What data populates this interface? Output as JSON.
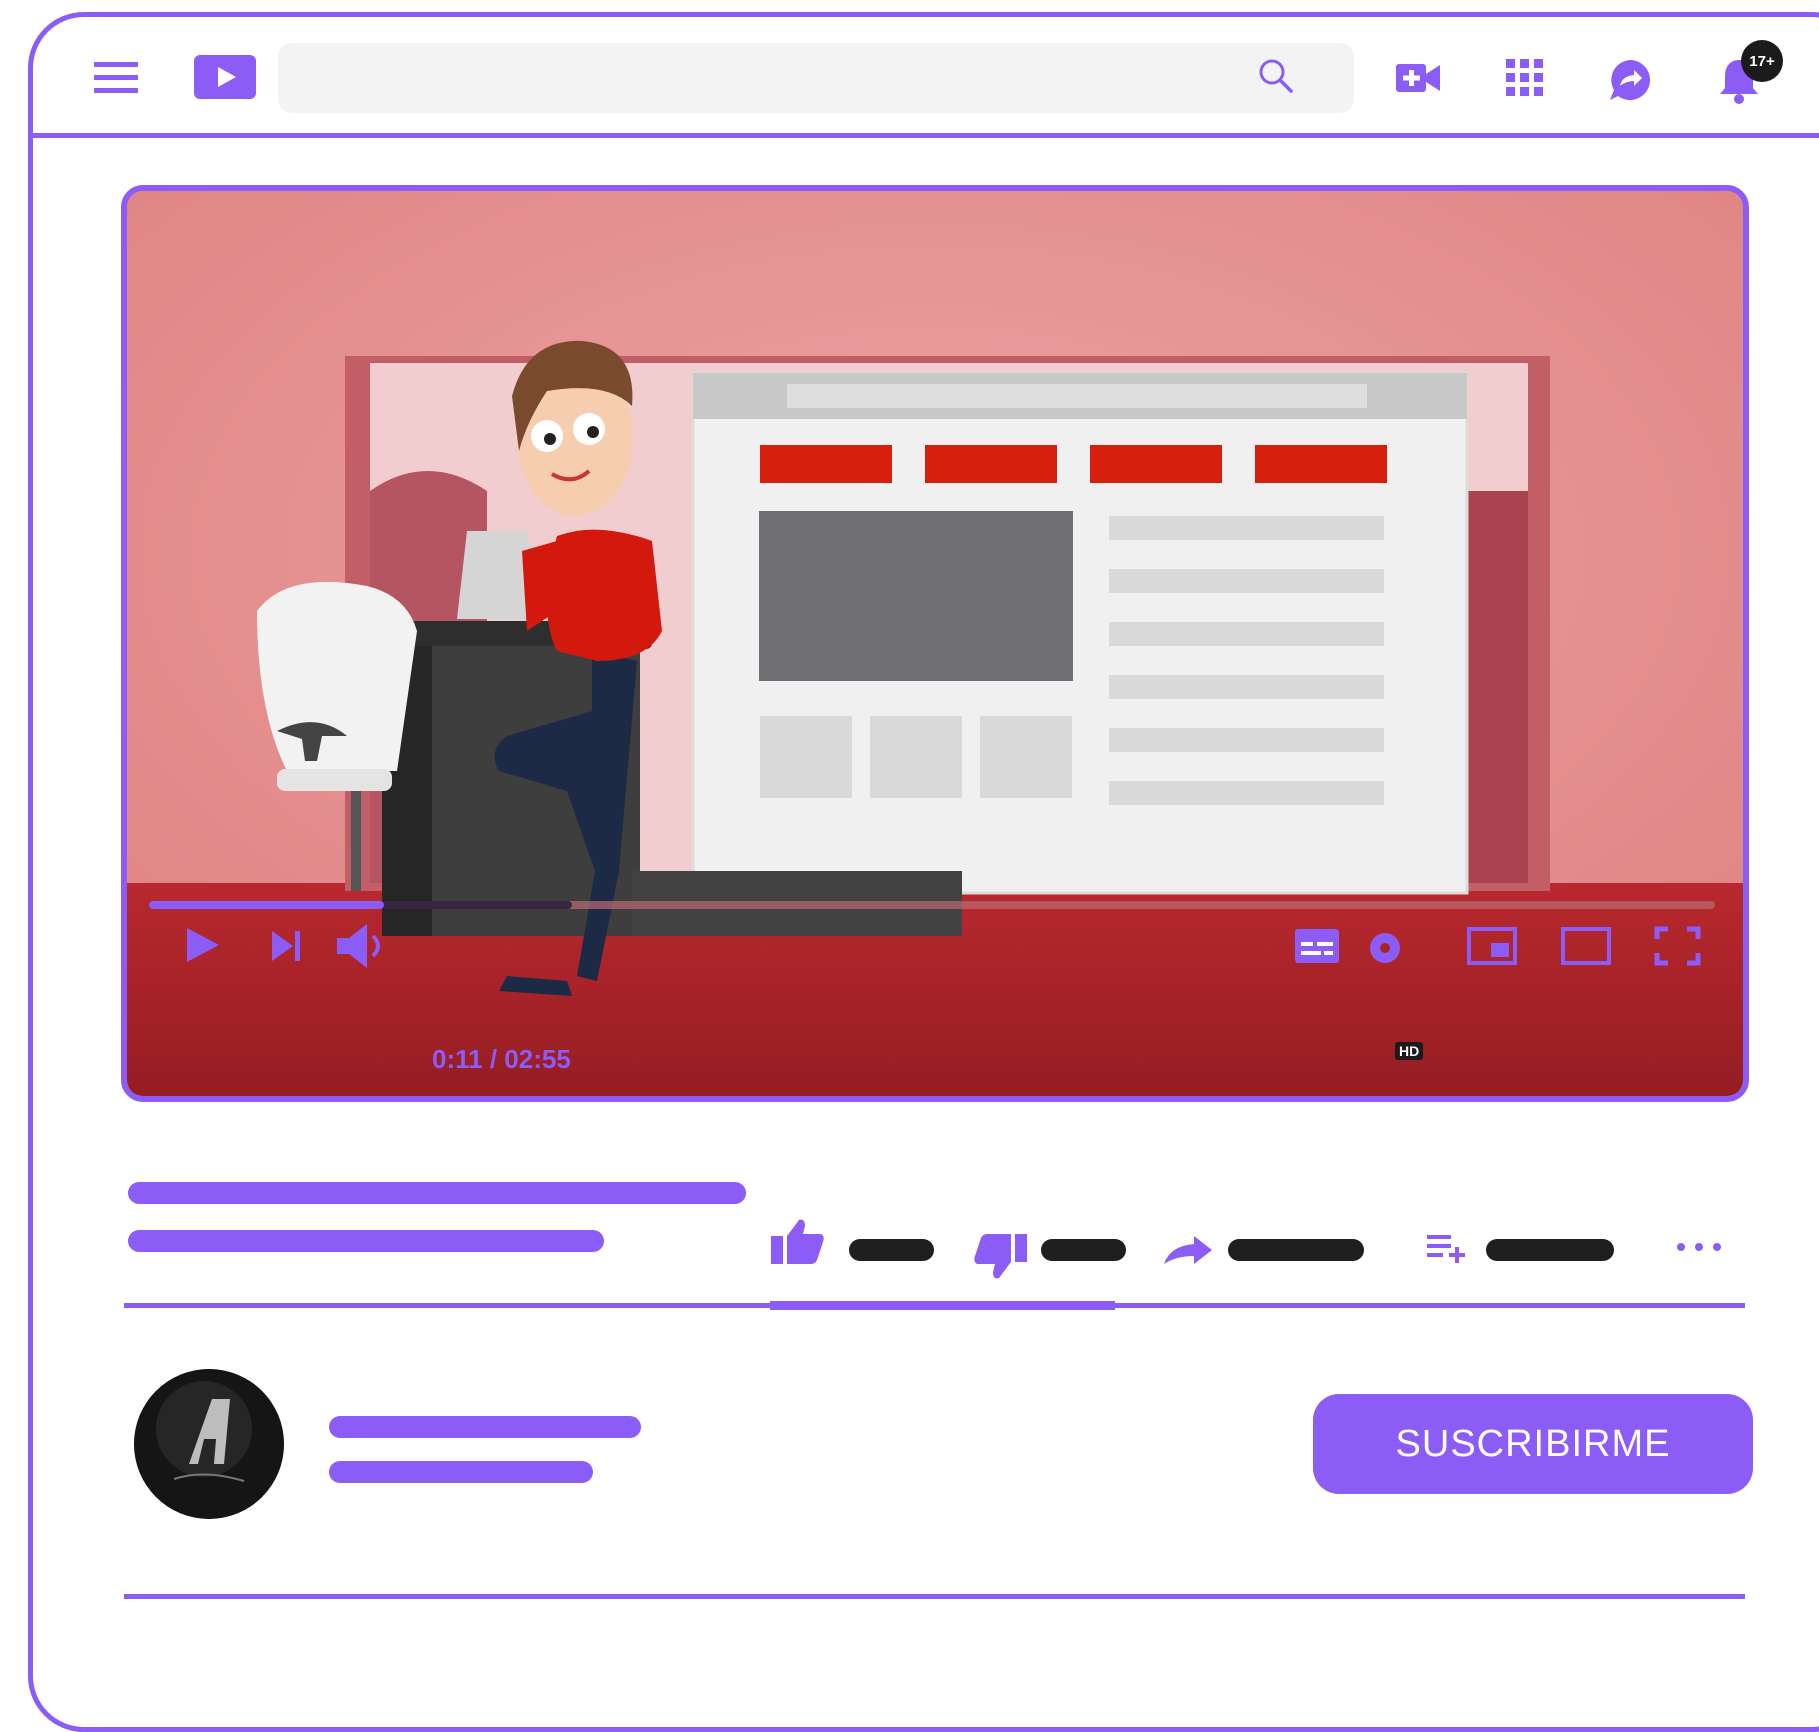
{
  "header": {
    "menu_icon": "hamburger-menu-icon",
    "logo_icon": "play-logo-icon",
    "search_placeholder": "",
    "search_icon": "search-icon",
    "create_icon": "video-camera-plus-icon",
    "apps_icon": "grid-apps-icon",
    "messages_icon": "share-chat-icon",
    "notifications_icon": "bell-icon",
    "notification_count": "17+"
  },
  "player": {
    "time_display": "0:11 / 02:55",
    "progress_fraction": 0.15,
    "buffered_fraction": 0.27,
    "quality_badge": "HD",
    "controls": [
      "play-icon",
      "next-icon",
      "volume-icon",
      "subtitles-icon",
      "settings-icon",
      "miniplayer-icon",
      "theater-icon",
      "fullscreen-icon"
    ]
  },
  "actions": [
    "thumbs-up-icon",
    "thumbs-down-icon",
    "share-icon",
    "add-to-playlist-icon",
    "more-icon"
  ],
  "channel": {
    "subscribe_label": "SUSCRIBIRME"
  },
  "colors": {
    "accent": "#8b5cf6",
    "placeholder_dark": "#1f1f1f",
    "video_bg": "#e48f90",
    "floor": "#b0252a"
  }
}
